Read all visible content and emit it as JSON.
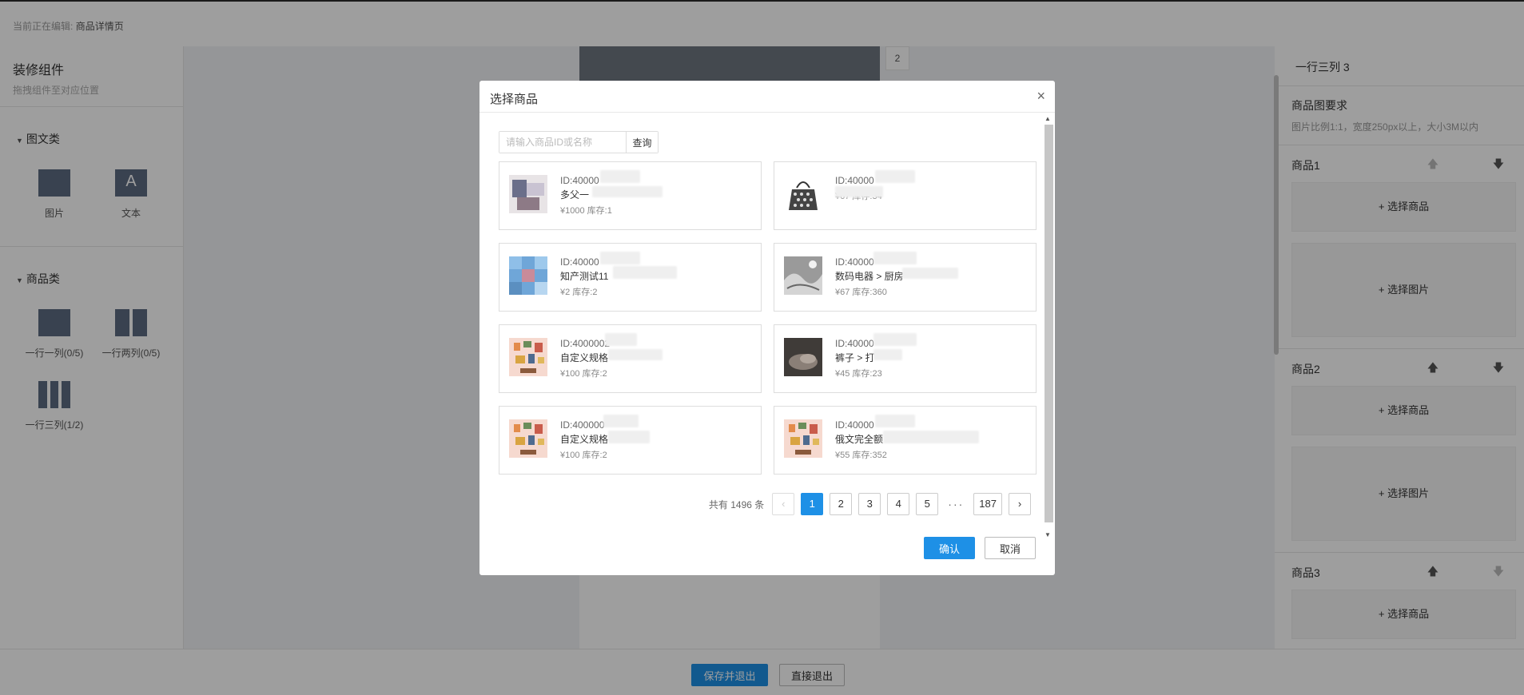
{
  "topbar": {
    "label": "当前正在编辑:",
    "page": "商品详情页"
  },
  "left": {
    "title": "装修组件",
    "subtitle": "拖拽组件至对应位置",
    "groups": [
      {
        "title": "图文类",
        "items": [
          {
            "label": "图片",
            "icon": "image-icon"
          },
          {
            "label": "文本",
            "icon": "text-icon",
            "glyph": "A"
          }
        ]
      },
      {
        "title": "商品类",
        "items": [
          {
            "label": "一行一列(0/5)",
            "icon": "one-column-icon"
          },
          {
            "label": "一行两列(0/5)",
            "icon": "two-column-icon"
          },
          {
            "label": "一行三列(1/2)",
            "icon": "three-column-icon"
          }
        ]
      }
    ]
  },
  "canvas": {
    "tag": "2"
  },
  "right": {
    "title": "一行三列 3",
    "req_title": "商品图要求",
    "req_sub": "图片比例1:1，宽度250px以上，大小3M以内",
    "pick_goods": "+ 选择商品",
    "pick_image": "+ 选择图片",
    "items": [
      {
        "name": "商品1"
      },
      {
        "name": "商品2"
      },
      {
        "name": "商品3"
      }
    ]
  },
  "bottom": {
    "save": "保存并退出",
    "exit": "直接退出"
  },
  "modal": {
    "title": "选择商品",
    "close": "×",
    "search_placeholder": "请输入商品ID或名称",
    "search_btn": "查询",
    "products": [
      {
        "id": "ID:40000",
        "name": "多父一",
        "meta": "¥1000 库存:1",
        "thumb": "photo"
      },
      {
        "id": "ID:40000",
        "name": "",
        "meta": "¥67 库存:34",
        "thumb": "bag"
      },
      {
        "id": "ID:40000",
        "name": "知产测试11",
        "meta": "¥2 库存:2",
        "thumb": "blue"
      },
      {
        "id": "ID:40000",
        "name": "数码电器 > 厨房",
        "meta": "¥67 库存:360",
        "thumb": "gray"
      },
      {
        "id": "ID:4000002",
        "name": "自定义规格",
        "meta": "¥100 库存:2",
        "thumb": "frames"
      },
      {
        "id": "ID:40000",
        "name": "裤子 > 打",
        "meta": "¥45 库存:23",
        "thumb": "dark"
      },
      {
        "id": "ID:400000",
        "name": "自定义规格",
        "meta": "¥100 库存:2",
        "thumb": "frames"
      },
      {
        "id": "ID:40000",
        "name": "俄文完全额",
        "meta": "¥55 库存:352",
        "thumb": "frames"
      }
    ],
    "pager": {
      "total": "共有 1496 条",
      "pages": [
        "1",
        "2",
        "3",
        "4",
        "5"
      ],
      "dots": "···",
      "last": "187",
      "prev": "‹",
      "next": "›"
    },
    "confirm": "确认",
    "cancel": "取消"
  },
  "colors": {
    "primary": "#1e90e6",
    "icon": "#5d6b82"
  }
}
